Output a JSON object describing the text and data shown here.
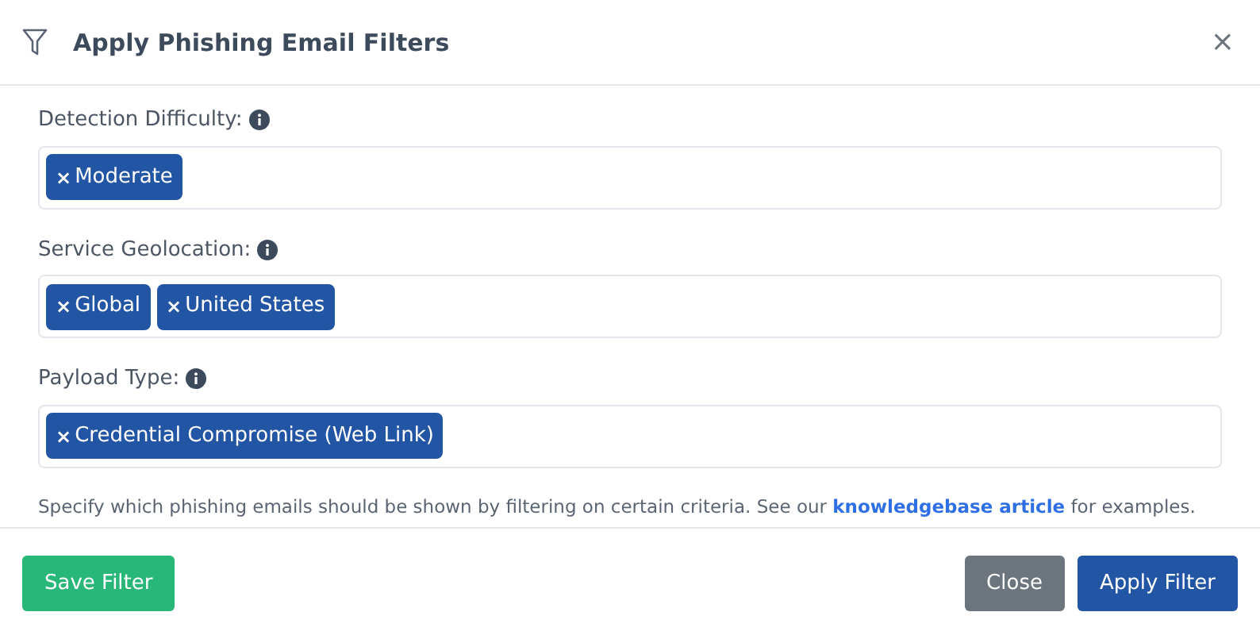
{
  "dialog": {
    "title": "Apply Phishing Email Filters",
    "close": "×"
  },
  "fields": [
    {
      "label": "Detection Difficulty:",
      "tags": [
        {
          "remove": "×",
          "label": "Moderate"
        }
      ]
    },
    {
      "label": "Service Geolocation:",
      "tags": [
        {
          "remove": "×",
          "label": "Global"
        },
        {
          "remove": "×",
          "label": "United States"
        }
      ]
    },
    {
      "label": "Payload Type:",
      "tags": [
        {
          "remove": "×",
          "label": "Credential Compromise (Web Link)"
        }
      ]
    }
  ],
  "help": {
    "before": "Specify which phishing emails should be shown by filtering on certain criteria. See our ",
    "link": "knowledgebase article",
    "after": " for examples."
  },
  "buttons": [
    {
      "kind": "save",
      "label": "Save Filter"
    },
    {
      "kind": "close",
      "label": "Close"
    },
    {
      "kind": "apply",
      "label": "Apply Filter"
    }
  ]
}
